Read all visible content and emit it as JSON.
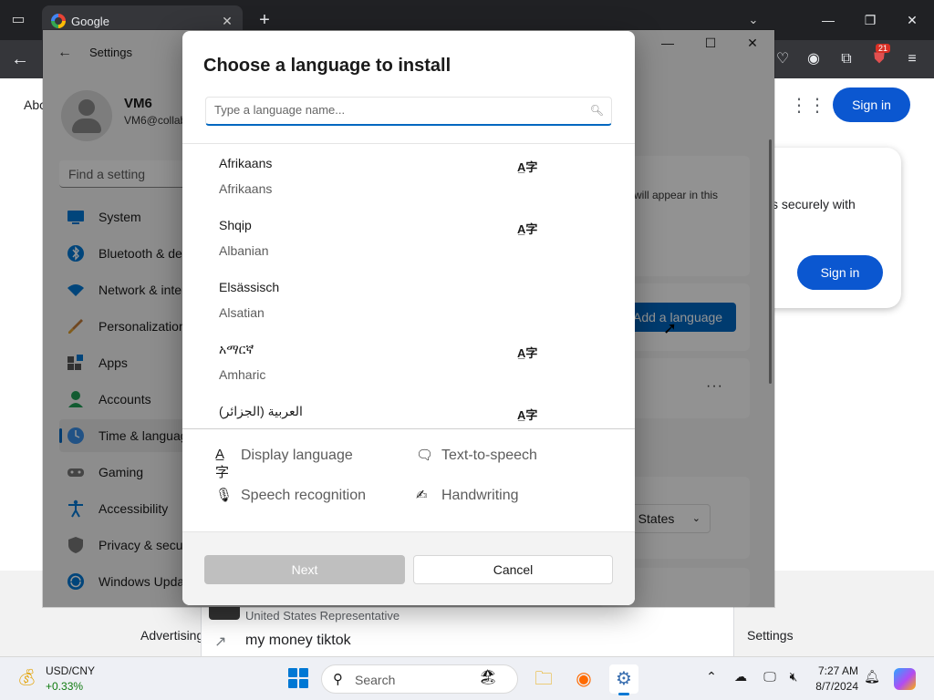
{
  "browser": {
    "tab_title": "Google",
    "close_tab_glyph": "✕",
    "new_tab_glyph": "+",
    "extension_badge": "21"
  },
  "google": {
    "about_link": "Abo",
    "signin_label": "Sign in",
    "card_text": "s securely with",
    "card_signin_label": "Sign in",
    "footer_advertising": "Advertising",
    "footer_settings": "Settings",
    "suggestion_subtitle": "United States Representative",
    "suggestion_query": "my money tiktok"
  },
  "settings_window": {
    "title": "Settings",
    "user_name": "VM6",
    "user_email": "VM6@collab",
    "search_placeholder": "Find a setting",
    "nav": [
      {
        "label": "System",
        "icon": "monitor-icon"
      },
      {
        "label": "Bluetooth & devices",
        "icon": "bluetooth-icon"
      },
      {
        "label": "Network & internet",
        "icon": "wifi-icon"
      },
      {
        "label": "Personalization",
        "icon": "brush-icon"
      },
      {
        "label": "Apps",
        "icon": "apps-icon"
      },
      {
        "label": "Accounts",
        "icon": "person-icon"
      },
      {
        "label": "Time & language",
        "icon": "clock-globe-icon"
      },
      {
        "label": "Gaming",
        "icon": "gamepad-icon"
      },
      {
        "label": "Accessibility",
        "icon": "accessibility-icon"
      },
      {
        "label": "Privacy & security",
        "icon": "shield-icon"
      },
      {
        "label": "Windows Update",
        "icon": "update-icon"
      }
    ],
    "panel_hint": "will appear in this",
    "add_language_label": "Add a language",
    "region_value": "d States",
    "more_glyph": "···"
  },
  "dialog": {
    "title": "Choose a language to install",
    "search_placeholder": "Type a language name...",
    "languages": [
      {
        "native": "Afrikaans",
        "english": "Afrikaans",
        "display_language": true
      },
      {
        "native": "Shqip",
        "english": "Albanian",
        "display_language": true
      },
      {
        "native": "Elsässisch",
        "english": "Alsatian",
        "display_language": false
      },
      {
        "native": "አማርኛ",
        "english": "Amharic",
        "display_language": true
      },
      {
        "native": "العربية (الجزائر)",
        "english": "",
        "display_language": true
      }
    ],
    "features": {
      "display_language": "Display language",
      "text_to_speech": "Text-to-speech",
      "speech_recognition": "Speech recognition",
      "handwriting": "Handwriting"
    },
    "next_label": "Next",
    "cancel_label": "Cancel"
  },
  "taskbar": {
    "stock_name": "USD/CNY",
    "stock_change": "+0.33%",
    "search_label": "Search",
    "time": "7:27 AM",
    "date": "8/7/2024"
  },
  "colors": {
    "accent": "#0067c0",
    "google_blue": "#0b57d0",
    "positive": "#0f7b0f"
  }
}
